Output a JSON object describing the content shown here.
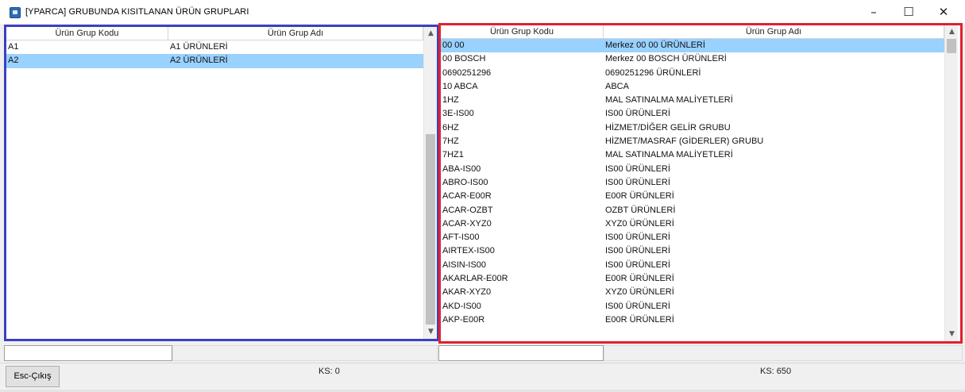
{
  "window": {
    "title": "[YPARCA] GRUBUNDA KISITLANAN ÜRÜN GRUPLARI",
    "minimize": "–",
    "maximize": "☐",
    "close": "✕"
  },
  "left_grid": {
    "columns": [
      "Ürün Grup Kodu",
      "Ürün Grup Adı"
    ],
    "rows": [
      [
        "A1",
        "A1 ÜRÜNLERİ"
      ],
      [
        "A2",
        "A2 ÜRÜNLERİ"
      ]
    ],
    "selected_row": 1,
    "scroll_up": "▲",
    "scroll_down": "▼"
  },
  "right_grid": {
    "columns": [
      "Ürün Grup Kodu",
      "Ürün Grup Adı"
    ],
    "rows": [
      [
        "00 00",
        "Merkez 00 00 ÜRÜNLERİ"
      ],
      [
        "00 BOSCH",
        "Merkez 00 BOSCH ÜRÜNLERİ"
      ],
      [
        "0690251296",
        "0690251296 ÜRÜNLERİ"
      ],
      [
        "10  ABCA",
        "ABCA"
      ],
      [
        "1HZ",
        "MAL SATINALMA MALİYETLERİ"
      ],
      [
        "3E-IS00",
        "IS00 ÜRÜNLERİ"
      ],
      [
        "6HZ",
        "HİZMET/DİĞER GELİR GRUBU"
      ],
      [
        "7HZ",
        "HİZMET/MASRAF (GİDERLER) GRUBU"
      ],
      [
        "7HZ1",
        "MAL SATINALMA MALİYETLERİ"
      ],
      [
        "ABA-IS00",
        "IS00 ÜRÜNLERİ"
      ],
      [
        "ABRO-IS00",
        "IS00 ÜRÜNLERİ"
      ],
      [
        "ACAR-E00R",
        "E00R ÜRÜNLERİ"
      ],
      [
        "ACAR-OZBT",
        "OZBT ÜRÜNLERİ"
      ],
      [
        "ACAR-XYZ0",
        "XYZ0 ÜRÜNLERİ"
      ],
      [
        "AFT-IS00",
        "IS00 ÜRÜNLERİ"
      ],
      [
        "AIRTEX-IS00",
        "IS00 ÜRÜNLERİ"
      ],
      [
        "AISIN-IS00",
        "IS00 ÜRÜNLERİ"
      ],
      [
        "AKARLAR-E00R",
        "E00R ÜRÜNLERİ"
      ],
      [
        "AKAR-XYZ0",
        "XYZ0 ÜRÜNLERİ"
      ],
      [
        "AKD-IS00",
        "IS00 ÜRÜNLERİ"
      ],
      [
        "AKP-E00R",
        "E00R ÜRÜNLERİ"
      ]
    ],
    "selected_row": 0,
    "scroll_up": "▲",
    "scroll_down": "▼"
  },
  "footer": {
    "esc_button": "Esc-Çıkış",
    "left_count": "KS: 0",
    "right_count": "KS: 650"
  },
  "colors": {
    "left_highlight": "#3c3fc2",
    "right_highlight": "#e0212f",
    "selection": "#99d1ff"
  }
}
